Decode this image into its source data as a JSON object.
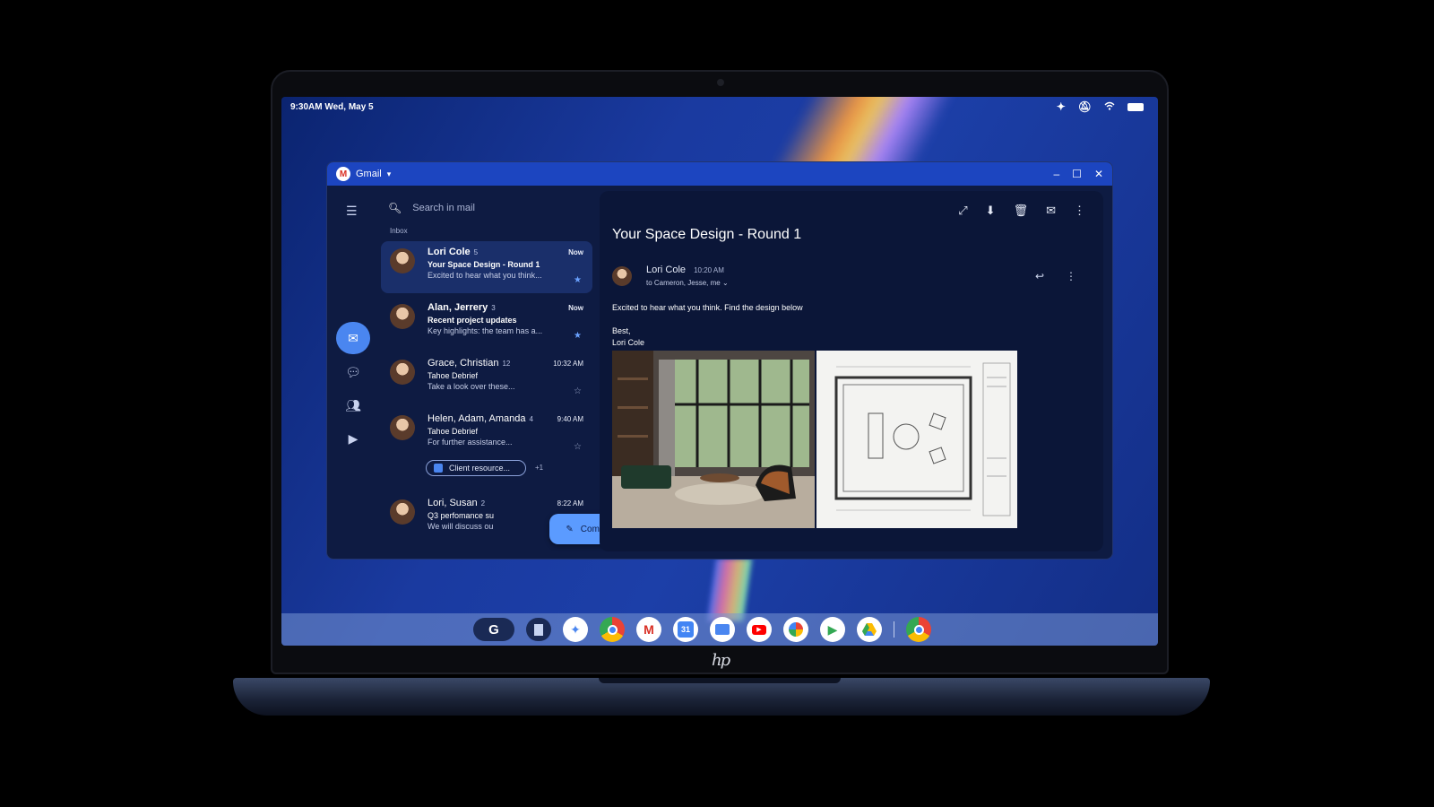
{
  "status_bar": {
    "time_date": "9:30AM  Wed, May 5"
  },
  "window": {
    "app_name": "Gmail"
  },
  "search": {
    "placeholder": "Search in mail"
  },
  "inbox_label": "Inbox",
  "emails": [
    {
      "from": "Lori Cole",
      "count": "5",
      "time": "Now",
      "subject": "Your Space Design - Round 1",
      "snippet": "Excited to hear what you think...",
      "starred": true
    },
    {
      "from": "Alan, Jerrery",
      "count": "3",
      "time": "Now",
      "subject": "Recent project updates",
      "snippet": "Key highlights: the team has a...",
      "starred": true
    },
    {
      "from": "Grace, Christian",
      "count": "12",
      "time": "10:32 AM",
      "subject": "Tahoe Debrief",
      "snippet": "Take a look over these...",
      "starred": false
    },
    {
      "from": "Helen, Adam, Amanda",
      "count": "4",
      "time": "9:40 AM",
      "subject": "Tahoe Debrief",
      "snippet": "For further assistance...",
      "starred": false,
      "chip": "Client resource...",
      "chip_more": "+1"
    },
    {
      "from": "Lori, Susan",
      "count": "2",
      "time": "8:22 AM",
      "subject": "Q3 perfomance su",
      "snippet": "We will discuss ou"
    }
  ],
  "compose_label": "Compose",
  "message": {
    "subject": "Your Space Design - Round 1",
    "sender": "Lori Cole",
    "time": "10:20 AM",
    "recipients": "to Cameron, Jesse, me",
    "body": "Excited to hear what you think. Find the design below",
    "signoff": "Best,",
    "signature": "Lori Cole"
  },
  "shelf": {
    "calendar_day": "31"
  },
  "brand": "hp"
}
